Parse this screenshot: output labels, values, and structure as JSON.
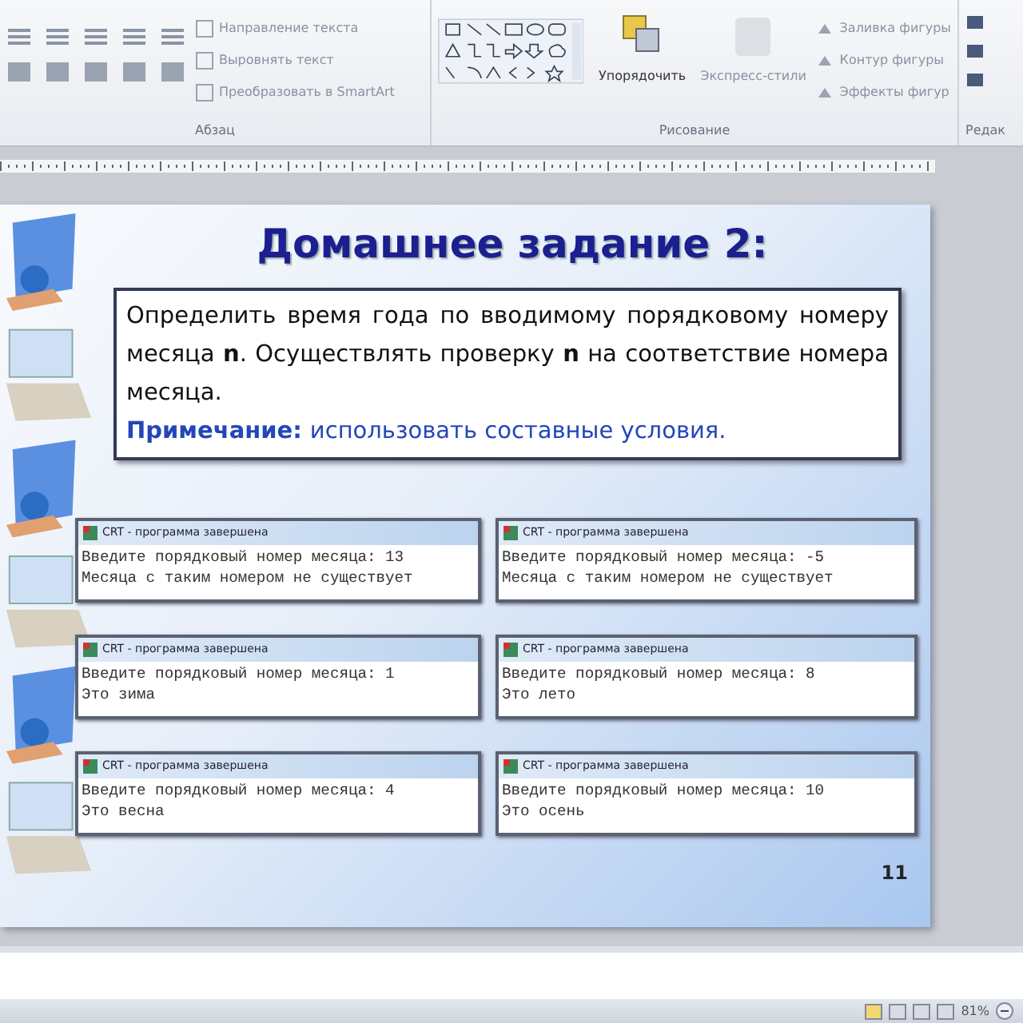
{
  "ribbon": {
    "paragraph_group": {
      "label": "Абзац",
      "commands": [
        "Направление текста",
        "Выровнять текст",
        "Преобразовать в SmartArt"
      ]
    },
    "drawing_group": {
      "label": "Рисование",
      "arrange": "Упорядочить",
      "quick_styles": "Экспресс-стили",
      "shape_commands": [
        "Заливка фигуры",
        "Контур фигуры",
        "Эффекты фигур"
      ]
    },
    "editing_group": {
      "label": "Редак"
    }
  },
  "slide": {
    "title": "Домашнее задание 2:",
    "task": "Определить время года по вводимому порядковому номеру месяца **n**. Осуществлять проверку **n** на соответствие номера месяца.",
    "note_label": "Примечание:",
    "note_text": "использовать составные условия.",
    "consoles": [
      {
        "title": "CRT - программа завершена",
        "lines": [
          "Введите порядковый номер месяца: 13",
          "Месяца с таким номером не существует"
        ]
      },
      {
        "title": "CRT - программа завершена",
        "lines": [
          "Введите порядковый номер месяца: -5",
          "Месяца с таким номером не существует"
        ]
      },
      {
        "title": "CRT - программа завершена",
        "lines": [
          "Введите порядковый номер месяца: 1",
          "Это зима"
        ]
      },
      {
        "title": "CRT - программа завершена",
        "lines": [
          "Введите порядковый номер месяца: 8",
          "Это лето"
        ]
      },
      {
        "title": "CRT - программа завершена",
        "lines": [
          "Введите порядковый номер месяца: 4",
          "Это весна"
        ]
      },
      {
        "title": "CRT - программа завершена",
        "lines": [
          "Введите порядковый номер месяца: 10",
          "Это осень"
        ]
      }
    ],
    "page_number": "11"
  },
  "status_bar": {
    "zoom": "81%"
  }
}
